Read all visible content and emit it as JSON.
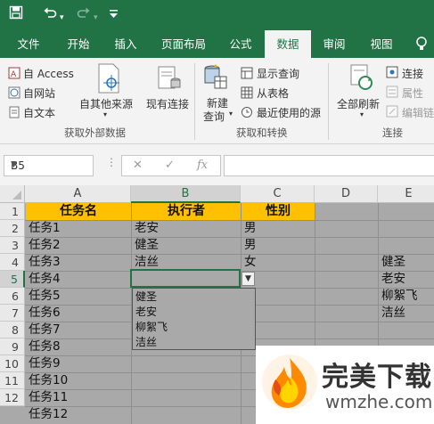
{
  "quick_access": {
    "save_icon": "save-icon",
    "undo_icon": "undo-icon",
    "redo_icon": "redo-icon",
    "customize_icon": "chevron-down-icon"
  },
  "ribbon_tabs": [
    {
      "label": "文件",
      "active": false
    },
    {
      "label": "开始",
      "active": false
    },
    {
      "label": "插入",
      "active": false
    },
    {
      "label": "页面布局",
      "active": false
    },
    {
      "label": "公式",
      "active": false
    },
    {
      "label": "数据",
      "active": true
    },
    {
      "label": "审阅",
      "active": false
    },
    {
      "label": "视图",
      "active": false
    }
  ],
  "ribbon": {
    "get_external_data": {
      "label": "获取外部数据",
      "from_access": "自 Access",
      "from_web": "自网站",
      "from_text": "自文本",
      "from_other": "自其他来源",
      "existing_connections": "现有连接"
    },
    "get_transform": {
      "label": "获取和转换",
      "new_query_line1": "新建",
      "new_query_line2": "查询",
      "show_queries": "显示查询",
      "from_table": "从表格",
      "recent_sources": "最近使用的源"
    },
    "connections": {
      "label": "连接",
      "refresh_all": "全部刷新",
      "connections": "连接",
      "properties": "属性",
      "edit_links": "编辑链"
    }
  },
  "formula_bar": {
    "name_box": "B5",
    "cancel": "✕",
    "enter": "✓",
    "fx": "fx",
    "content": ""
  },
  "grid": {
    "columns": [
      "A",
      "B",
      "C",
      "D",
      "E"
    ],
    "selected_column": "B",
    "rows": [
      "1",
      "2",
      "3",
      "4",
      "5",
      "6",
      "7",
      "8",
      "9",
      "10",
      "11",
      "12"
    ],
    "selected_row": "5",
    "header": {
      "a": "任务名",
      "b": "执行者",
      "c": "性别"
    },
    "col_a": [
      "任务1",
      "任务2",
      "任务3",
      "任务4",
      "任务5",
      "任务6",
      "任务7",
      "任务8",
      "任务9",
      "任务10",
      "任务11",
      "任务12"
    ],
    "col_b": [
      "老安",
      "健圣",
      "洁丝"
    ],
    "col_c": [
      "男",
      "男",
      "女"
    ],
    "col_e": [
      "健圣",
      "老安",
      "柳絮飞",
      "洁丝"
    ],
    "dropdown_items": [
      "健圣",
      "老安",
      "柳絮飞",
      "洁丝"
    ]
  },
  "watermark": {
    "title": "完美下载",
    "url": "wmzhe.com",
    "logo_icon": "flame-logo-icon"
  }
}
